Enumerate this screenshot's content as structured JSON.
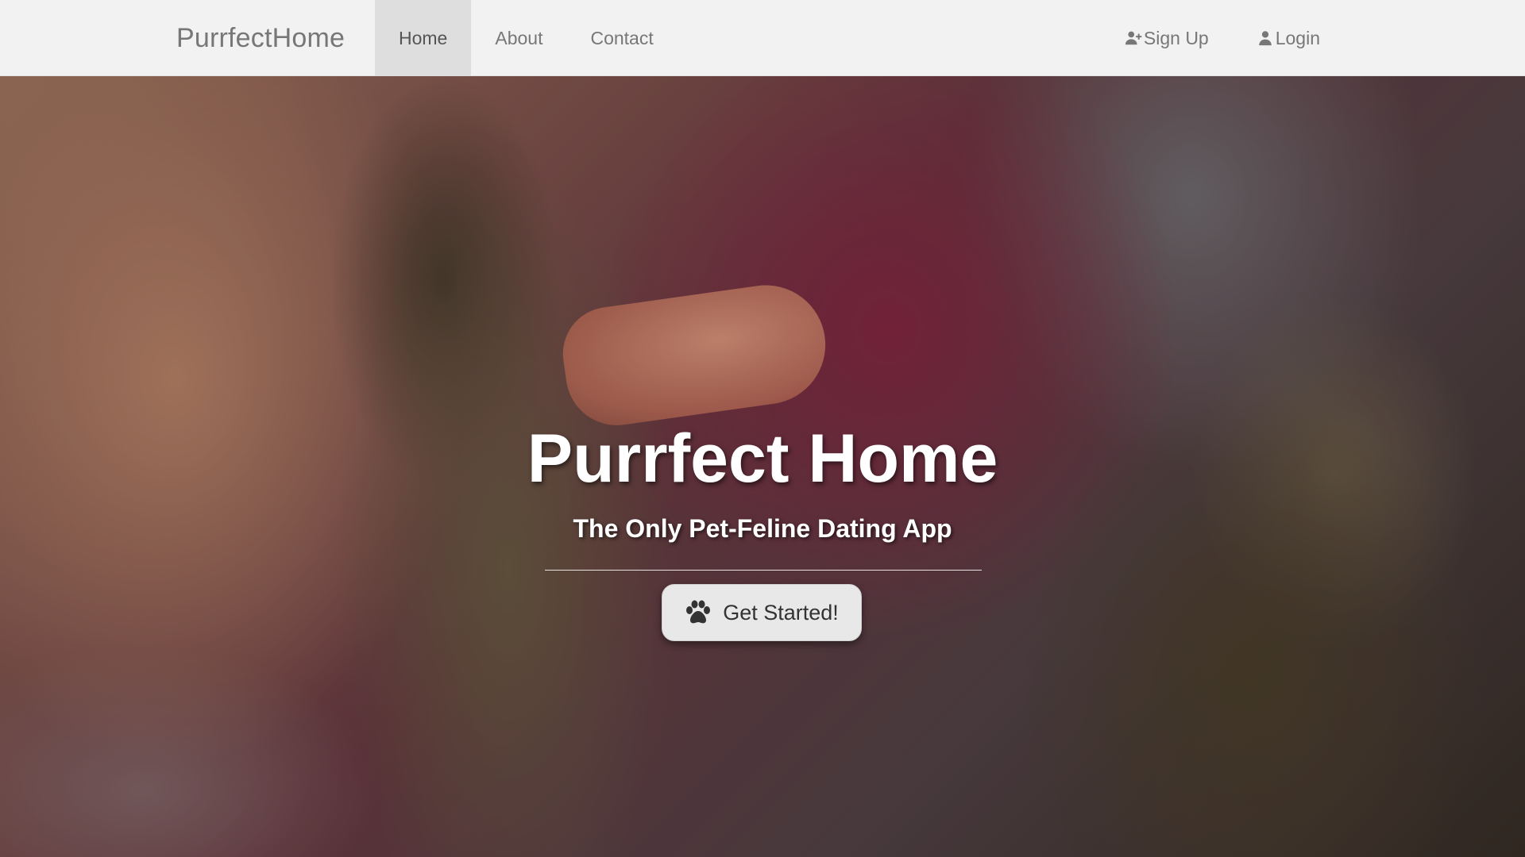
{
  "navbar": {
    "brand": "PurrfectHome",
    "links": [
      {
        "label": "Home",
        "active": true
      },
      {
        "label": "About",
        "active": false
      },
      {
        "label": "Contact",
        "active": false
      }
    ],
    "right": [
      {
        "label": "Sign Up",
        "icon": "user-plus-icon"
      },
      {
        "label": "Login",
        "icon": "user-icon"
      }
    ]
  },
  "hero": {
    "title": "Purrfect Home",
    "subtitle": "The Only Pet-Feline Dating App",
    "cta": {
      "label": "Get Started!",
      "icon": "paw-icon"
    }
  },
  "colors": {
    "navbar_bg": "#f2f2f2",
    "nav_text": "#777777",
    "active_bg": "#dedede",
    "hero_text": "#ffffff",
    "cta_bg": "#e8e8e8"
  }
}
